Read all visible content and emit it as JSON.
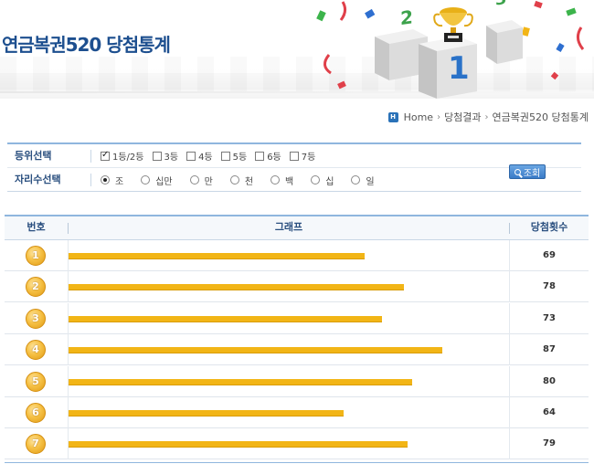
{
  "page": {
    "title": "연금복권520 당첨통계"
  },
  "breadcrumb": {
    "items": [
      "Home",
      "당첨결과",
      "연금복권520 당첨통계"
    ]
  },
  "filter": {
    "rank_label": "등위선택",
    "rank_options": [
      {
        "label": "1등/2등",
        "checked": true
      },
      {
        "label": "3등",
        "checked": false
      },
      {
        "label": "4등",
        "checked": false
      },
      {
        "label": "5등",
        "checked": false
      },
      {
        "label": "6등",
        "checked": false
      },
      {
        "label": "7등",
        "checked": false
      }
    ],
    "digit_label": "자리수선택",
    "digit_options": [
      {
        "label": "조",
        "checked": true
      },
      {
        "label": "십만",
        "checked": false
      },
      {
        "label": "만",
        "checked": false
      },
      {
        "label": "천",
        "checked": false
      },
      {
        "label": "백",
        "checked": false
      },
      {
        "label": "십",
        "checked": false
      },
      {
        "label": "일",
        "checked": false
      }
    ],
    "search_label": "조회"
  },
  "table": {
    "headers": {
      "number": "번호",
      "graph": "그래프",
      "count": "당첨횟수"
    },
    "bar_color": "#f2b516",
    "max_count": 100
  },
  "chart_data": {
    "type": "bar",
    "categories": [
      "1",
      "2",
      "3",
      "4",
      "5",
      "6",
      "7"
    ],
    "values": [
      69,
      78,
      73,
      87,
      80,
      64,
      79
    ]
  }
}
